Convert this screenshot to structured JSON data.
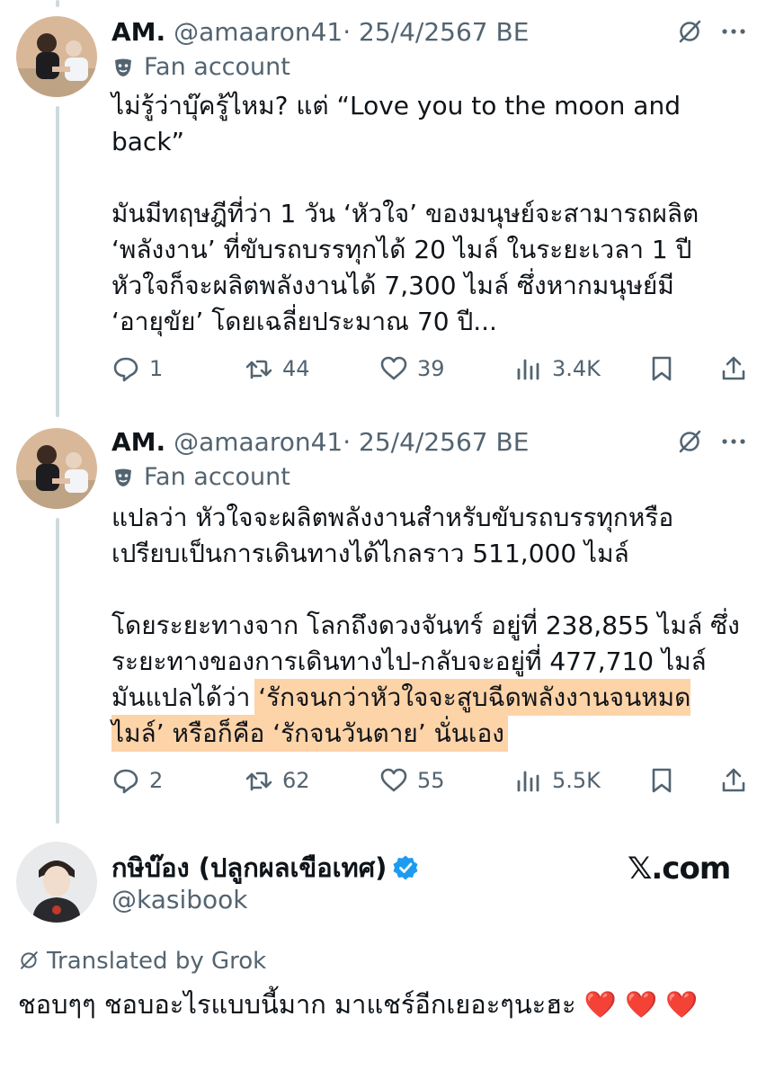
{
  "tweets": [
    {
      "name": "AM.",
      "handle": "@amaaron41",
      "separator": "·",
      "date": "25/4/2567 BE",
      "label": "Fan account",
      "text": "ไม่รู้ว่าบุ๊ครู้ไหม? แต่ “Love you to the moon and back”\n\nมันมีทฤษฎีที่ว่า 1 วัน ‘หัวใจ’ ของมนุษย์จะสามารถผลิต ‘พลังงาน’ ที่ขับรถบรรทุกได้ 20 ไมล์ ในระยะเวลา 1 ปี หัวใจก็จะผลิตพลังงานได้ 7,300 ไมล์ ซึ่งหากมนุษย์มี ‘อายุขัย’ โดยเฉลี่ยประมาณ 70 ปี...",
      "replies": "1",
      "reposts": "44",
      "likes": "39",
      "views": "3.4K"
    },
    {
      "name": "AM.",
      "handle": "@amaaron41",
      "separator": "·",
      "date": "25/4/2567 BE",
      "label": "Fan account",
      "text_plain": "แปลว่า หัวใจจะผลิตพลังงานสำหรับขับรถบรรทุกหรือเปรียบเป็นการเดินทางได้ไกลราว 511,000 ไมล์\n\nโดยระยะทางจาก โลกถึงดวงจันทร์ อยู่ที่ 238,855 ไมล์ ซึ่งระยะทางของการเดินทางไป-กลับจะอยู่ที่ 477,710 ไมล์ มันแปลได้ว่า ",
      "text_highlight": "‘รักจนกว่าหัวใจจะสูบฉีดพลังงานจนหมดไมล์’ หรือก็คือ ‘รักจนวันตาย’ นั่นเอง",
      "replies": "2",
      "reposts": "62",
      "likes": "55",
      "views": "5.5K"
    }
  ],
  "quote": {
    "name": "กษิบ๊อง (ปลูกผลเขือเทศ)",
    "handle": "@kasibook",
    "brand": "𝕏.com",
    "translated": "Translated by Grok",
    "reply_text": "ชอบๆๆ ชอบอะไรแบบนี้มาก มาแชร์อีกเยอะๆนะฮะ",
    "reply_emoji": "❤️ ❤️ ❤️"
  },
  "colors": {
    "text": "#0f1419",
    "secondary": "#536471",
    "highlight": "#fdd3a8",
    "verified": "#1d9bf0",
    "heart": "#dd2e44"
  }
}
